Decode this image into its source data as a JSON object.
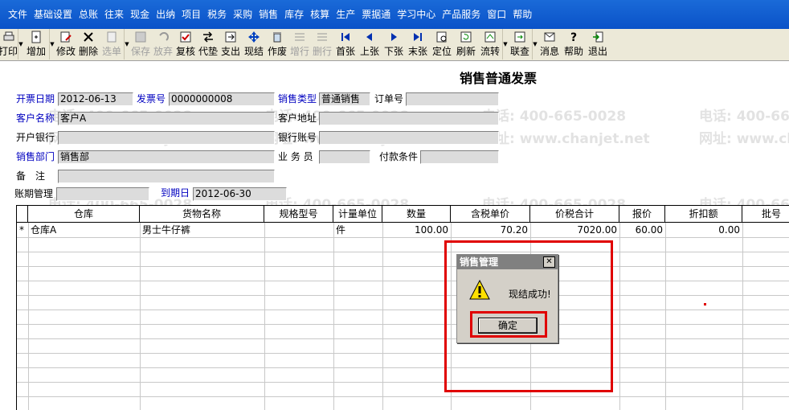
{
  "menu": [
    "文件",
    "基础设置",
    "总账",
    "往来",
    "现金",
    "出纳",
    "项目",
    "税务",
    "采购",
    "销售",
    "库存",
    "核算",
    "生产",
    "票据通",
    "学习中心",
    "产品服务",
    "窗口",
    "帮助"
  ],
  "toolbar": {
    "print": "打印",
    "add": "增加",
    "modify": "修改",
    "delete": "删除",
    "select": "选单",
    "save": "保存",
    "abandon": "放弃",
    "review": "复核",
    "advance": "代垫",
    "pay": "支出",
    "cash_settle": "现结",
    "void": "作废",
    "add_row": "增行",
    "delete_row": "删行",
    "first": "首张",
    "prev": "上张",
    "next": "下张",
    "last": "末张",
    "locate": "定位",
    "refresh": "刷新",
    "flow": "流转",
    "link": "联查",
    "message": "消息",
    "help": "帮助",
    "exit": "退出"
  },
  "watermark": {
    "phone": "电话: 400-665-0028",
    "site": "网址: www.chanjet.net"
  },
  "form": {
    "title": "销售普通发票",
    "invoice_date_label": "开票日期",
    "invoice_date": "2012-06-13",
    "invoice_no_label": "发票号",
    "invoice_no": "0000000008",
    "sales_type_label": "销售类型",
    "sales_type": "普通销售",
    "order_no_label": "订单号",
    "order_no": "",
    "customer_label": "客户名称",
    "customer": "客户A",
    "customer_addr_label": "客户地址",
    "customer_addr": "",
    "bank_label": "开户银行",
    "bank": "",
    "bank_account_label": "银行账号",
    "bank_account": "",
    "department_label": "销售部门",
    "department": "销售部",
    "salesperson_label": "业 务 员",
    "salesperson": "",
    "payment_terms_label": "付款条件",
    "payment_terms": "",
    "remark_label": "备　注",
    "remark": "",
    "period_label": "账期管理",
    "period": "",
    "due_date_label": "到期日",
    "due_date": "2012-06-30"
  },
  "grid": {
    "headers": [
      "仓库",
      "货物名称",
      "规格型号",
      "计量单位",
      "数量",
      "含税单价",
      "价税合计",
      "报价",
      "折扣额",
      "批号"
    ],
    "rows": [
      {
        "marker": "*",
        "warehouse": "仓库A",
        "goods": "男士牛仔裤",
        "spec": "",
        "unit": "件",
        "qty": "100.00",
        "unit_price": "70.20",
        "total": "7020.00",
        "quote": "60.00",
        "discount": "0.00",
        "batch": ""
      }
    ]
  },
  "dialog": {
    "title": "销售管理",
    "close": "✕",
    "message": "现结成功!",
    "ok_label": "确定"
  },
  "colors": {
    "menubar": "#0a52c8",
    "toolbar": "#ece9d8",
    "label_blue": "#0000c0",
    "field_bg": "#dcdcdc",
    "highlight_red": "#e00000"
  }
}
